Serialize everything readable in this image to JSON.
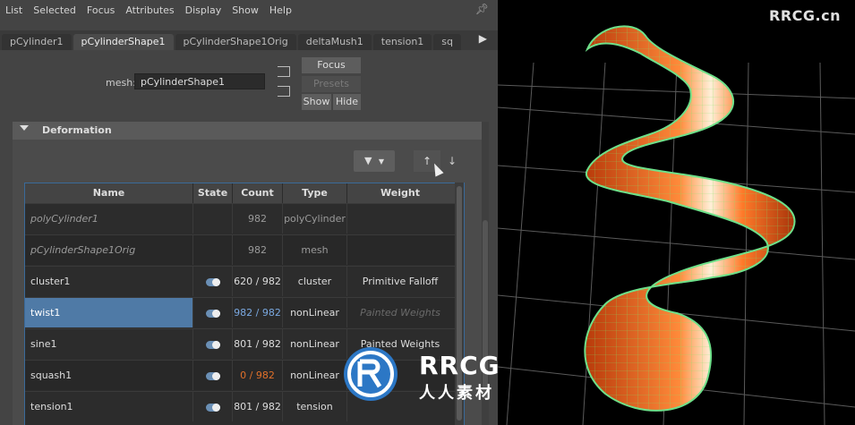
{
  "menu": [
    "List",
    "Selected",
    "Focus",
    "Attributes",
    "Display",
    "Show",
    "Help"
  ],
  "tabs": [
    {
      "label": "pCylinder1",
      "active": false
    },
    {
      "label": "pCylinderShape1",
      "active": true
    },
    {
      "label": "pCylinderShape1Orig",
      "active": false
    },
    {
      "label": "deltaMush1",
      "active": false
    },
    {
      "label": "tension1",
      "active": false
    },
    {
      "label": "sq",
      "active": false
    }
  ],
  "mesh": {
    "label": "mesh:",
    "value": "pCylinderShape1"
  },
  "buttons": {
    "focus": "Focus",
    "presets": "Presets",
    "show": "Show",
    "hide": "Hide"
  },
  "section": {
    "title": "Deformation"
  },
  "table": {
    "headers": [
      "Name",
      "State",
      "Count",
      "Type",
      "Weight"
    ],
    "rows": [
      {
        "name": "polyCylinder1",
        "state": "",
        "count": "982",
        "type": "polyCylinder",
        "weight": ""
      },
      {
        "name": "pCylinderShape1Orig",
        "state": "",
        "count": "982",
        "type": "mesh",
        "weight": ""
      },
      {
        "name": "cluster1",
        "state": "on",
        "count": "620 / 982",
        "type": "cluster",
        "weight": "Primitive Falloff"
      },
      {
        "name": "twist1",
        "state": "on",
        "count": "982 / 982",
        "type": "nonLinear",
        "weight": "Painted Weights"
      },
      {
        "name": "sine1",
        "state": "on",
        "count": "801 / 982",
        "type": "nonLinear",
        "weight": "Painted Weights"
      },
      {
        "name": "squash1",
        "state": "on",
        "count": "0 / 982",
        "type": "nonLinear",
        "weight": ""
      },
      {
        "name": "tension1",
        "state": "on",
        "count": "801 / 982",
        "type": "tension",
        "weight": ""
      }
    ]
  },
  "watermark": {
    "top": "RRCG.cn",
    "logo": "RRCG",
    "logo_sub": "人人素材"
  },
  "colors": {
    "selection": "#4f7aa6",
    "mesh_orange": "#f0621e",
    "wireframe": "#6ee08a"
  }
}
